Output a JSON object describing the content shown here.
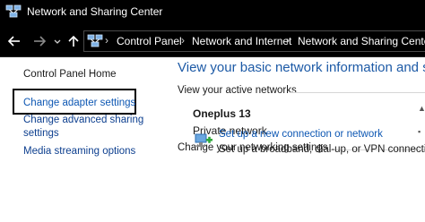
{
  "window": {
    "title": "Network and Sharing Center",
    "icon": "network-center-icon"
  },
  "address_bar": {
    "breadcrumbs": [
      "Control Panel",
      "Network and Internet",
      "Network and Sharing Center"
    ]
  },
  "left_pane": {
    "items": [
      {
        "label": "Control Panel Home"
      },
      {
        "label": "Change adapter settings"
      },
      {
        "label": "Change advanced sharing"
      },
      {
        "label": "settings"
      },
      {
        "label": "Media streaming options"
      }
    ]
  },
  "main": {
    "title": "View your basic network information and set",
    "active_networks_label": "View your active networks",
    "network": {
      "name": "Oneplus 13",
      "type": "Private network"
    },
    "change_settings_label": "Change your networking settings",
    "task": {
      "link": "Set up a new connection or network",
      "description": "Set up a broadband, dial-up, or VPN connection"
    }
  },
  "colors": {
    "titlebar_bg": "#000000",
    "link": "#0d57b3",
    "heading": "#1d5aa6"
  }
}
